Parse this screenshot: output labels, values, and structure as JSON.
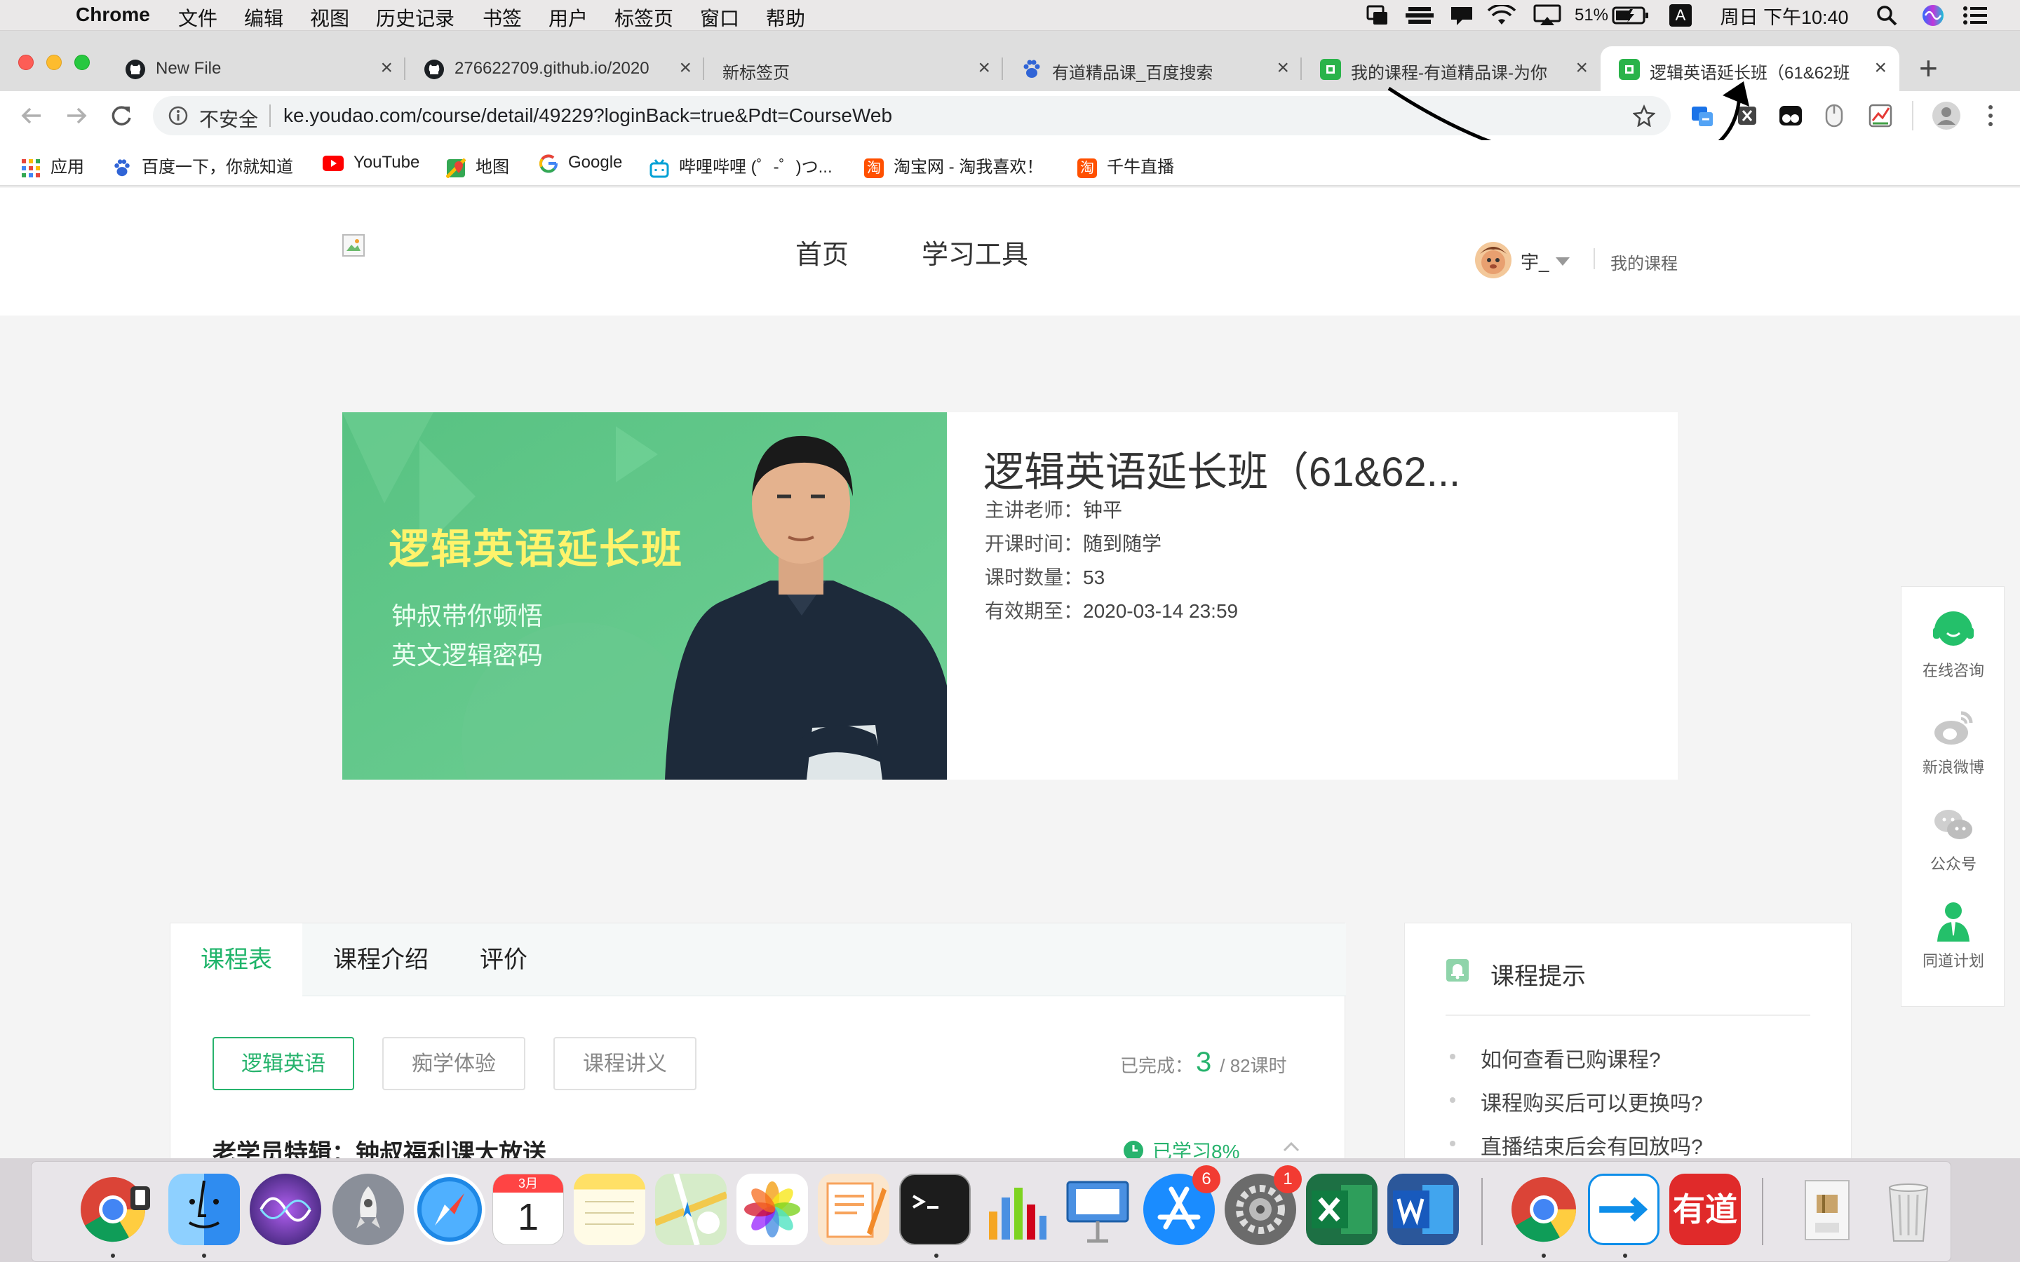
{
  "menubar": {
    "app": "Chrome",
    "menus": [
      "文件",
      "编辑",
      "视图",
      "历史记录",
      "书签",
      "用户",
      "标签页",
      "窗口",
      "帮助"
    ],
    "battery": "51%",
    "input_method": "A",
    "clock": "周日 下午10:40"
  },
  "tabs": [
    {
      "title": "New File",
      "icon": "github-icon"
    },
    {
      "title": "276622709.github.io/2020",
      "icon": "github-icon"
    },
    {
      "title": "新标签页",
      "icon": ""
    },
    {
      "title": "有道精品课_百度搜索",
      "icon": "baidu-paw-icon"
    },
    {
      "title": "我的课程-有道精品课-为你",
      "icon": "youdao-icon"
    },
    {
      "title": "逻辑英语延长班（61&62班",
      "icon": "youdao-icon"
    }
  ],
  "toolbar": {
    "insecure_label": "不安全",
    "url": "ke.youdao.com/course/detail/49229?loginBack=true&Pdt=CourseWeb"
  },
  "bookmarks": [
    {
      "label": "应用",
      "icon": "apps-grid-icon",
      "color": "#e8453c"
    },
    {
      "label": "百度一下，你就知道",
      "icon": "baidu-paw-icon",
      "color": "#3064d6"
    },
    {
      "label": "YouTube",
      "icon": "youtube-icon",
      "color": "#ff0000"
    },
    {
      "label": "地图",
      "icon": "maps-pin-icon",
      "color": "#34a853"
    },
    {
      "label": "Google",
      "icon": "google-g-icon",
      "color": "#4285f4"
    },
    {
      "label": "哔哩哔哩 (゜-゜)つ...",
      "icon": "bilibili-tv-icon",
      "color": "#00a1d6"
    },
    {
      "label": "淘宝网 - 淘我喜欢！",
      "icon": "taobao-icon",
      "color": "#ff5000"
    },
    {
      "label": "千牛直播",
      "icon": "taobao-icon",
      "color": "#ff5000"
    }
  ],
  "site": {
    "nav": [
      "首页",
      "学习工具"
    ],
    "user_name": "宇_",
    "my_courses": "我的课程"
  },
  "course": {
    "title": "逻辑英语延长班（61&62...",
    "banner_title": "逻辑英语延长班",
    "banner_line1": "钟叔带你顿悟",
    "banner_line2": "英文逻辑密码",
    "teacher_label": "主讲老师：",
    "teacher": "钟平",
    "start_label": "开课时间：",
    "start": "随到随学",
    "lessons_label": "课时数量：",
    "lessons": "53",
    "valid_label": "有效期至：",
    "valid": "2020-03-14 23:59"
  },
  "schedule": {
    "tabs": [
      "课程表",
      "课程介绍",
      "评价"
    ],
    "filters": [
      "逻辑英语",
      "痴学体验",
      "课程讲义"
    ],
    "done_label": "已完成：",
    "done_count": "3",
    "total": "/ 82课时",
    "section_title": "老学员特辑：钟叔福利课大放送",
    "progress_label": "已学习8%"
  },
  "tips": {
    "title": "课程提示",
    "items": [
      "如何查看已购课程?",
      "课程购买后可以更换吗?",
      "直播结束后会有回放吗?"
    ]
  },
  "float_bar": [
    "在线咨询",
    "新浪微博",
    "公众号",
    "同道计划"
  ],
  "dock": {
    "items": [
      {
        "name": "chrome",
        "color": "#e0e0e0"
      },
      {
        "name": "finder",
        "color": "#2f8cf0"
      },
      {
        "name": "siri",
        "color": "#3a2a7a"
      },
      {
        "name": "launchpad",
        "color": "#8a8f99"
      },
      {
        "name": "safari",
        "color": "#1e88e5"
      },
      {
        "name": "calendar",
        "color": "#ffffff"
      },
      {
        "name": "notes",
        "color": "#fff3a0"
      },
      {
        "name": "maps",
        "color": "#7cc46e"
      },
      {
        "name": "photos",
        "color": "#ffffff"
      },
      {
        "name": "pages",
        "color": "#f7a35c"
      },
      {
        "name": "terminal",
        "color": "#1c1c1c"
      },
      {
        "name": "numbers",
        "color": "#eeeeee"
      },
      {
        "name": "keynote",
        "color": "#4a90e2"
      },
      {
        "name": "app-store",
        "color": "#1a8cff"
      },
      {
        "name": "system-preferences",
        "color": "#6b6b6b"
      },
      {
        "name": "excel",
        "color": "#1d7044"
      },
      {
        "name": "word",
        "color": "#2b579a"
      },
      {
        "name": "chrome-2",
        "color": "#e0e0e0"
      },
      {
        "name": "teamviewer",
        "color": "#0e8ee9"
      },
      {
        "name": "youdao",
        "color": "#e02a2a"
      },
      {
        "name": "archive",
        "color": "#d8c9a4"
      },
      {
        "name": "trash",
        "color": "#d9d9d9"
      }
    ],
    "calendar_month": "3月",
    "calendar_day": "1",
    "appstore_badge": "6",
    "prefs_badge": "1",
    "youdao_label": "有道"
  }
}
